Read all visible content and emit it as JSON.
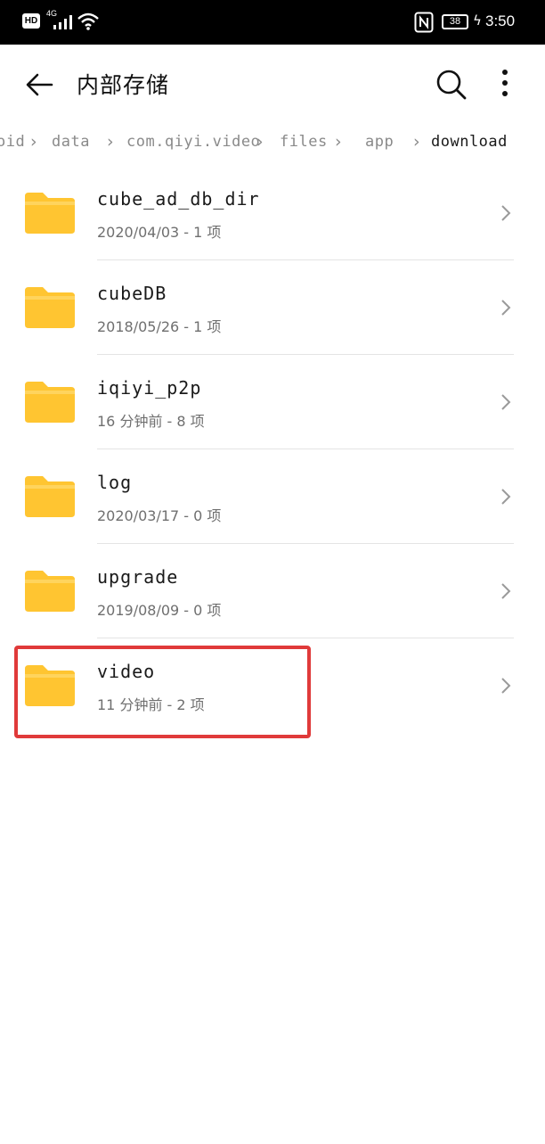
{
  "status_bar": {
    "hd": "HD",
    "network": "4G",
    "battery": "38",
    "time": "3:50",
    "icons": [
      "signal-icon",
      "wifi-icon",
      "nfc-icon",
      "battery-icon",
      "charging-icon"
    ]
  },
  "header": {
    "title": "内部存储",
    "back_icon": "back-arrow-icon",
    "search_icon": "search-icon",
    "more_icon": "more-vert-icon"
  },
  "breadcrumb": [
    "oid",
    "data",
    "com.qiyi.video",
    "files",
    "app",
    "download"
  ],
  "files": [
    {
      "name": "cube_ad_db_dir",
      "meta": "2020/04/03 - 1 项"
    },
    {
      "name": "cubeDB",
      "meta": "2018/05/26 - 1 项"
    },
    {
      "name": "iqiyi_p2p",
      "meta": "16 分钟前 - 8 项"
    },
    {
      "name": "log",
      "meta": "2020/03/17 - 0 项"
    },
    {
      "name": "upgrade",
      "meta": "2019/08/09 - 0 项"
    },
    {
      "name": "video",
      "meta": "11 分钟前 - 2 项"
    }
  ],
  "highlighted_item": "video",
  "colors": {
    "folder": "#FFC531",
    "folder_tab": "#FFE082",
    "highlight": "#E03A3A",
    "status_bar": "#000000"
  }
}
